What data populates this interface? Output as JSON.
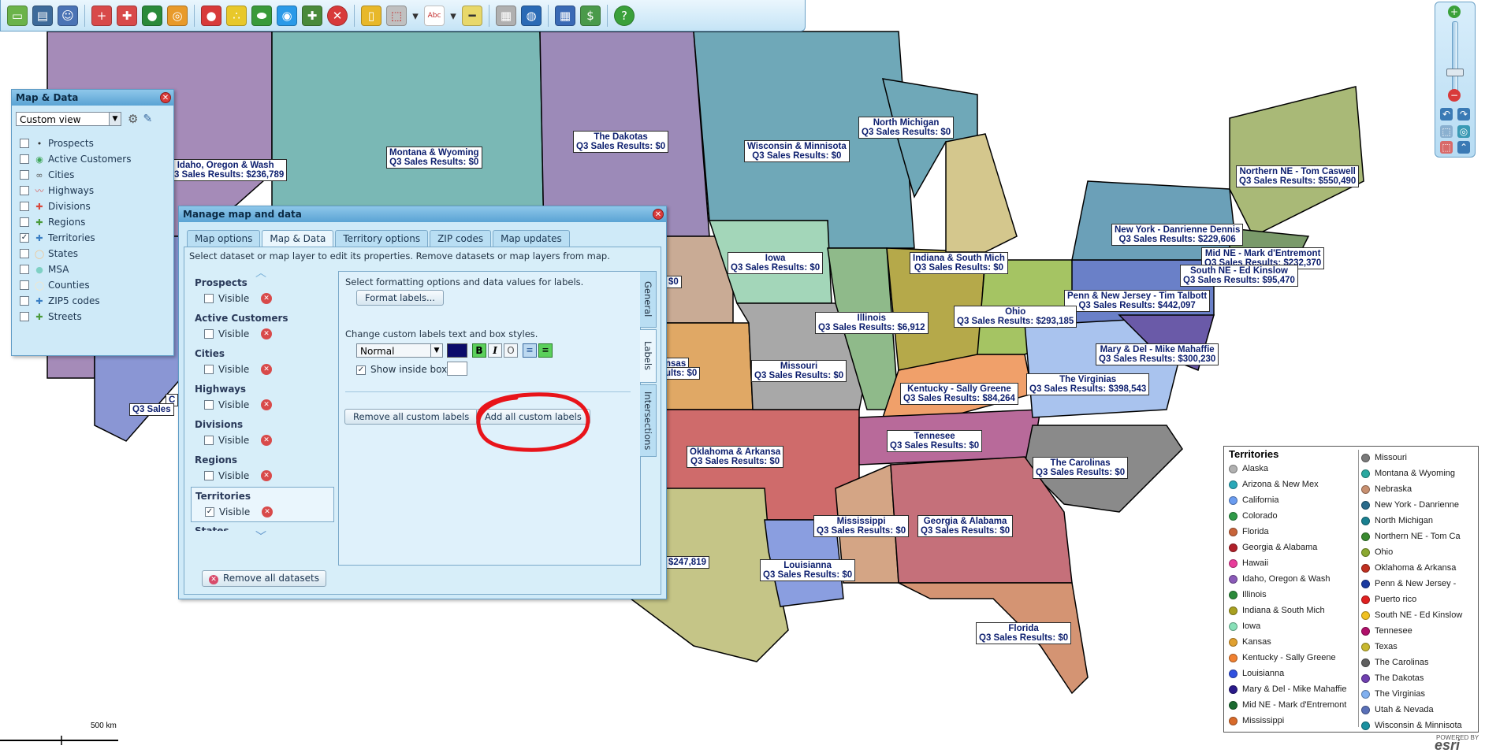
{
  "toolbar": {
    "icons": [
      "open-folder",
      "save",
      "people",
      "add-marker",
      "puzzle-regions",
      "globe",
      "target",
      "dots",
      "bubbles",
      "oval",
      "radar",
      "puzzle-territory",
      "remove",
      "notebook",
      "select",
      "text-label",
      "ruler",
      "printer",
      "web-globe",
      "calendar",
      "money",
      "help"
    ]
  },
  "map_data_panel": {
    "title": "Map & Data",
    "view_value": "Custom view",
    "layers": [
      {
        "label": "Prospects",
        "checked": false,
        "icon": "dot-icon",
        "color": "#333333"
      },
      {
        "label": "Active Customers",
        "checked": false,
        "icon": "target-icon",
        "color": "#3fa65a"
      },
      {
        "label": "Cities",
        "checked": false,
        "icon": "cities-icon",
        "color": "#555555"
      },
      {
        "label": "Highways",
        "checked": false,
        "icon": "highway-icon",
        "color": "#d9534f"
      },
      {
        "label": "Divisions",
        "checked": false,
        "icon": "divisions-icon",
        "color": "#d9473b"
      },
      {
        "label": "Regions",
        "checked": false,
        "icon": "regions-icon",
        "color": "#4a9a3a"
      },
      {
        "label": "Territories",
        "checked": true,
        "icon": "territories-icon",
        "color": "#3b7fc4"
      },
      {
        "label": "States",
        "checked": false,
        "icon": "states-icon",
        "color": "#f2c38a"
      },
      {
        "label": "MSA",
        "checked": false,
        "icon": "msa-icon",
        "color": "#7fd1c4"
      },
      {
        "label": "Counties",
        "checked": false,
        "icon": "counties-icon",
        "color": "#f7e6c4"
      },
      {
        "label": "ZIP5 codes",
        "checked": false,
        "icon": "zip-icon",
        "color": "#3b7fc4"
      },
      {
        "label": "Streets",
        "checked": false,
        "icon": "streets-icon",
        "color": "#4a9a3a"
      }
    ]
  },
  "manage_panel": {
    "title": "Manage map and data",
    "tabs": [
      "Map options",
      "Map & Data",
      "Territory options",
      "ZIP codes",
      "Map updates"
    ],
    "active_tab": 1,
    "instruction": "Select dataset or map layer to edit its properties. Remove datasets or map layers from map.",
    "datasets": [
      {
        "name": "Prospects",
        "visible_label": "Visible",
        "checked": false
      },
      {
        "name": "Active Customers",
        "visible_label": "Visible",
        "checked": false
      },
      {
        "name": "Cities",
        "visible_label": "Visible",
        "checked": false
      },
      {
        "name": "Highways",
        "visible_label": "Visible",
        "checked": false
      },
      {
        "name": "Divisions",
        "visible_label": "Visible",
        "checked": false
      },
      {
        "name": "Regions",
        "visible_label": "Visible",
        "checked": false
      },
      {
        "name": "Territories",
        "visible_label": "Visible",
        "checked": true
      },
      {
        "name": "States",
        "visible_label": "Visible",
        "checked": false
      }
    ],
    "remove_all_datasets": "Remove all datasets",
    "side_tabs": [
      "General",
      "Labels",
      "Intersections"
    ],
    "format_text": "Select formatting options and data values for labels.",
    "format_button": "Format labels...",
    "custom_text": "Change custom labels text and box styles.",
    "style_value": "Normal",
    "bold": "B",
    "italic": "I",
    "outline": "O",
    "show_inside_box": "Show inside box",
    "remove_custom_labels": "Remove all custom labels",
    "add_custom_labels": "Add all custom labels"
  },
  "map_labels": [
    {
      "name": "Montana & Wyoming",
      "value": "Q3 Sales Results:  $0"
    },
    {
      "name": "The Dakotas",
      "value": "Q3 Sales Results:  $0"
    },
    {
      "name": "Idaho, Oregon & Wash",
      "value": "Q3 Sales Results: $236,789"
    },
    {
      "name": "Wisconsin & Minnisota",
      "value": "Q3 Sales Results:  $0"
    },
    {
      "name": "North Michigan",
      "value": "Q3 Sales Results:  $0"
    },
    {
      "name": "Northern NE - Tom Caswell",
      "value": "Q3 Sales Results:  $550,490"
    },
    {
      "name": "New York - Danrienne Dennis",
      "value": "Q3 Sales Results:  $229,606"
    },
    {
      "name": "Mid NE - Mark d'Entremont",
      "value": "Q3 Sales Results:  $232,370"
    },
    {
      "name": "South NE - Ed Kinslow",
      "value": "Q3 Sales Results:  $95,470"
    },
    {
      "name": "Iowa",
      "value": "Q3 Sales Results:  $0"
    },
    {
      "name": "Indiana & South Mich",
      "value": "Q3 Sales Results:  $0"
    },
    {
      "name": "Penn & New Jersey - Tim Talbott",
      "value": "Q3 Sales Results:  $442,097"
    },
    {
      "name": "Illinois",
      "value": "Q3 Sales Results:  $6,912"
    },
    {
      "name": "Ohio",
      "value": "Q3 Sales Results:  $293,185"
    },
    {
      "name": "Mary & Del - Mike Mahaffie",
      "value": "Q3 Sales Results:  $300,230"
    },
    {
      "name": "Missouri",
      "value": "Q3 Sales Results:  $0"
    },
    {
      "name": "The Virginias",
      "value": "Q3 Sales Results:  $398,543"
    },
    {
      "name": "Kentucky - Sally Greene",
      "value": "Q3 Sales Results:  $84,264"
    },
    {
      "name": "Tennesee",
      "value": "Q3 Sales Results:  $0"
    },
    {
      "name": "The Carolinas",
      "value": "Q3 Sales Results:  $0"
    },
    {
      "name": "Oklahoma & Arkansa",
      "value": "Q3 Sales Results:  $0"
    },
    {
      "name": "Mississippi",
      "value": "Q3 Sales Results:  $0"
    },
    {
      "name": "Georgia & Alabama",
      "value": "Q3 Sales Results:  $0"
    },
    {
      "name": "Louisianna",
      "value": "Q3 Sales Results:  $0"
    },
    {
      "name": "Florida",
      "value": "Q3 Sales Results:  $0"
    }
  ],
  "partial_labels": [
    "$0",
    "nsas",
    "ults:  $0",
    "$247,819",
    "C",
    "Q3 Sales"
  ],
  "legend": {
    "title": "Territories",
    "col1": [
      {
        "label": "Alaska",
        "color": "#b0b0b0"
      },
      {
        "label": "Arizona & New Mex",
        "color": "#2aa8b8"
      },
      {
        "label": "California",
        "color": "#6a9cf0"
      },
      {
        "label": "Colorado",
        "color": "#2f9a48"
      },
      {
        "label": "Florida",
        "color": "#c8643a"
      },
      {
        "label": "Georgia & Alabama",
        "color": "#b0202a"
      },
      {
        "label": "Hawaii",
        "color": "#e83c9a"
      },
      {
        "label": "Idaho, Oregon &  Wash",
        "color": "#8a5ab8"
      },
      {
        "label": "Illinois",
        "color": "#2a8a3a"
      },
      {
        "label": "Indiana & South Mich",
        "color": "#a8a020"
      },
      {
        "label": "Iowa",
        "color": "#88e0b8"
      },
      {
        "label": "Kansas",
        "color": "#e0a030"
      },
      {
        "label": "Kentucky - Sally Greene",
        "color": "#f08030"
      },
      {
        "label": "Louisianna",
        "color": "#3050e0"
      },
      {
        "label": "Mary & Del - Mike Mahaffie",
        "color": "#2a1a8a"
      },
      {
        "label": "Mid NE - Mark d'Entremont",
        "color": "#1a6a30"
      },
      {
        "label": "Mississippi",
        "color": "#d86a2a"
      }
    ],
    "col2": [
      {
        "label": "Missouri",
        "color": "#7a7a7a"
      },
      {
        "label": "Montana & Wyoming",
        "color": "#2aa8a0"
      },
      {
        "label": "Nebraska",
        "color": "#c89070"
      },
      {
        "label": "New York - Danrienne",
        "color": "#2a6a8a"
      },
      {
        "label": "North Michigan",
        "color": "#1a8090"
      },
      {
        "label": "Northern NE - Tom Ca",
        "color": "#3a8a30"
      },
      {
        "label": "Ohio",
        "color": "#8aa830"
      },
      {
        "label": "Oklahoma & Arkansa",
        "color": "#c03020"
      },
      {
        "label": "Penn & New Jersey - ",
        "color": "#1a3aa0"
      },
      {
        "label": "Puerto rico",
        "color": "#e02020"
      },
      {
        "label": "South NE - Ed Kinslow",
        "color": "#f0c020"
      },
      {
        "label": "Tennesee",
        "color": "#b0106a"
      },
      {
        "label": "Texas",
        "color": "#c8b830"
      },
      {
        "label": "The Carolinas",
        "color": "#606060"
      },
      {
        "label": "The Dakotas",
        "color": "#7040b0"
      },
      {
        "label": "The Virginias",
        "color": "#80b0f0"
      },
      {
        "label": "Utah & Nevada",
        "color": "#5a70b8"
      },
      {
        "label": "Wisconsin & Minnisota",
        "color": "#1a90a0"
      }
    ]
  },
  "scale": {
    "label": "500 km"
  },
  "brand": {
    "powered": "POWERED BY",
    "name": "esri"
  }
}
